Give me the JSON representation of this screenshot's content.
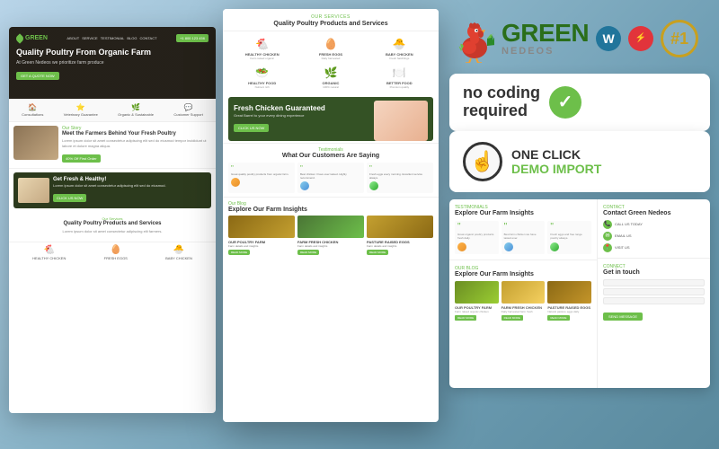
{
  "brand": {
    "name_top": "GREEN",
    "name_bottom": "NEDEOS",
    "wp_label": "W",
    "el_label": "e",
    "number_one": "#1"
  },
  "badges": {
    "no_coding_line1": "no coding",
    "no_coding_line2": "required",
    "one_click_line1": "ONE CLICK",
    "one_click_line2": "DEMO IMPORT"
  },
  "left_mockup": {
    "logo": "GREEN",
    "hero_title": "Quality Poultry From\nOrganic Farm",
    "hero_sub": "At Green Nedeos we prioritize farm produce",
    "hero_cta": "GET A QUOTE NOW",
    "features": [
      "Consultations",
      "Veterinary Guarantee",
      "Organic & Sustainable",
      "Customer Support"
    ],
    "story_title": "Meet the Farmers Behind Your Fresh Poultry",
    "story_cta": "40% Off First Order",
    "promo_title": "Get Fresh & Healthy!",
    "products": [
      "HEALTHY CHICKEN",
      "FRESH EGGS",
      "BABY CHICKEN"
    ]
  },
  "center_mockup": {
    "tag": "Our Services",
    "title": "Quality Poultry Products and Services",
    "products": [
      {
        "name": "HEALTHY CHICKEN",
        "icon": "🐔"
      },
      {
        "name": "FRESH EGGS",
        "icon": "🥚"
      },
      {
        "name": "BABY CHICKEN",
        "icon": "🐣"
      },
      {
        "name": "HEALTHY FOOD",
        "icon": "🥗"
      },
      {
        "name": "ORGANIC",
        "icon": "🌿"
      },
      {
        "name": "BETTER FOOD",
        "icon": "🍽️"
      }
    ],
    "banner_title": "Fresh Chicken Guaranteed",
    "banner_sub": "Great Barrel to your every dining experience",
    "banner_btn": "CLICK US NOW",
    "testimonials_tag": "Testimonials",
    "testimonials_title": "What Our Customers Are Saying",
    "blog_tag": "Our Blog",
    "blog_title": "Explore Our Farm Insights"
  },
  "right_mockup": {
    "testimonials_tag": "Testimonials",
    "testimonials_title": "Explore Our Farm Insights",
    "blog_tag": "Our Blog",
    "blog_title": "Explore Our Farm Insights",
    "blog_items": [
      "OUR POULTRY FARM",
      "FARM FRESH CHICKEN",
      "PASTURE RAISED EGGS"
    ],
    "contact_tag": "Contact",
    "contact_title": "Contact Green Nedeos",
    "contact_items": [
      "CALL US TODAY",
      "EMAIL US",
      "VISIT US"
    ],
    "touch_tag": "Connect",
    "touch_title": "Get in touch"
  }
}
